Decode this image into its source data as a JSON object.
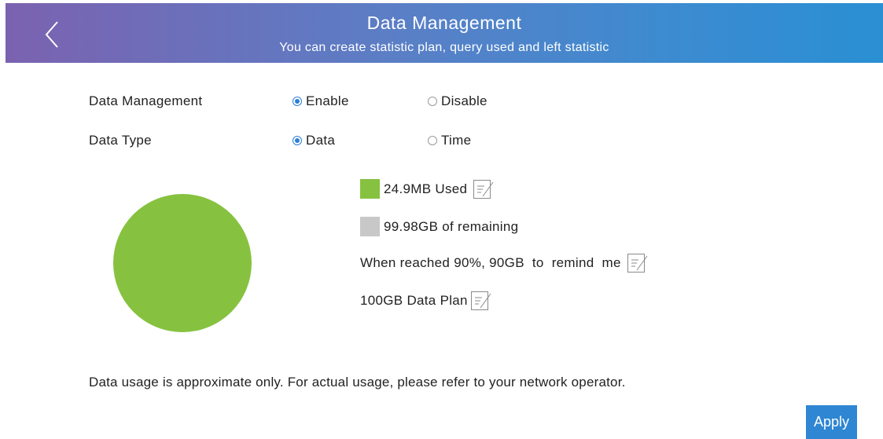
{
  "header": {
    "title": "Data Management",
    "subtitle": "You can create statistic plan, query used and left statistic",
    "back_icon": "chevron-left-icon"
  },
  "form": {
    "data_management": {
      "label": "Data Management",
      "options": [
        {
          "label": "Enable",
          "checked": true
        },
        {
          "label": "Disable",
          "checked": false
        }
      ]
    },
    "data_type": {
      "label": "Data Type",
      "options": [
        {
          "label": "Data",
          "checked": true
        },
        {
          "label": "Time",
          "checked": false
        }
      ]
    }
  },
  "usage": {
    "used_label": "24.9MB Used",
    "remaining_label": "99.98GB of remaining",
    "remind_label": "When reached 90%, 90GB  to  remind  me",
    "plan_label": "100GB Data Plan",
    "used_color": "#86c240",
    "remaining_color": "#c8c8c8"
  },
  "note": "Data usage is approximate only. For actual usage, please refer to your network operator.",
  "apply_label": "Apply"
}
